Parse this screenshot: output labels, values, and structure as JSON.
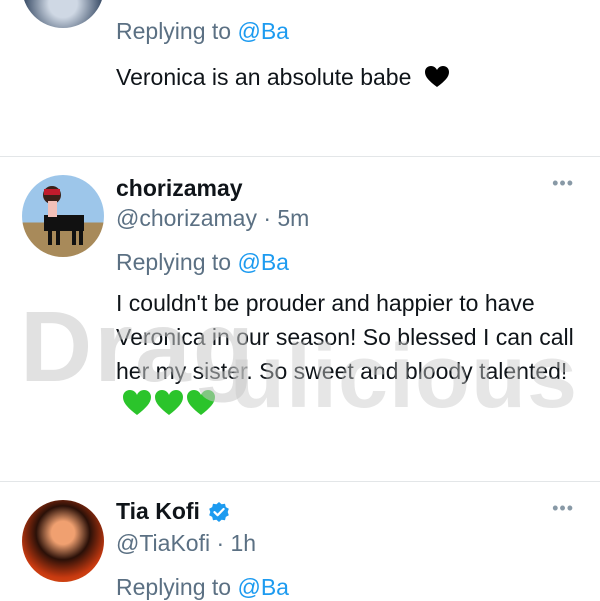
{
  "colors": {
    "accent": "#1d9bf0",
    "muted": "#5b7083",
    "heart_black": "#000000",
    "heart_green": "#2bc42b"
  },
  "tweets": [
    {
      "reply_prefix": "Replying to ",
      "reply_to": "@Ba",
      "text": "Veronica is an absolute babe",
      "emoji": "black-heart"
    },
    {
      "name": "chorizamay",
      "handle": "@chorizamay",
      "time": " · 5m",
      "reply_prefix": "Replying to ",
      "reply_to": "@Ba",
      "text": "I couldn't be prouder and happier to have Veronica in our season! So blessed I can call her my sister. So sweet  and bloody talented!",
      "emoji": "green-hearts"
    },
    {
      "name": "Tia Kofi",
      "handle": "@TiaKofi",
      "time": " · 1h",
      "reply_prefix": "Replying to ",
      "reply_to": "@Ba"
    }
  ],
  "watermark": {
    "line1": "Drag",
    "line2": "ulicious"
  },
  "icons": {
    "more": "more-options-icon",
    "verified": "verified-badge-icon"
  }
}
